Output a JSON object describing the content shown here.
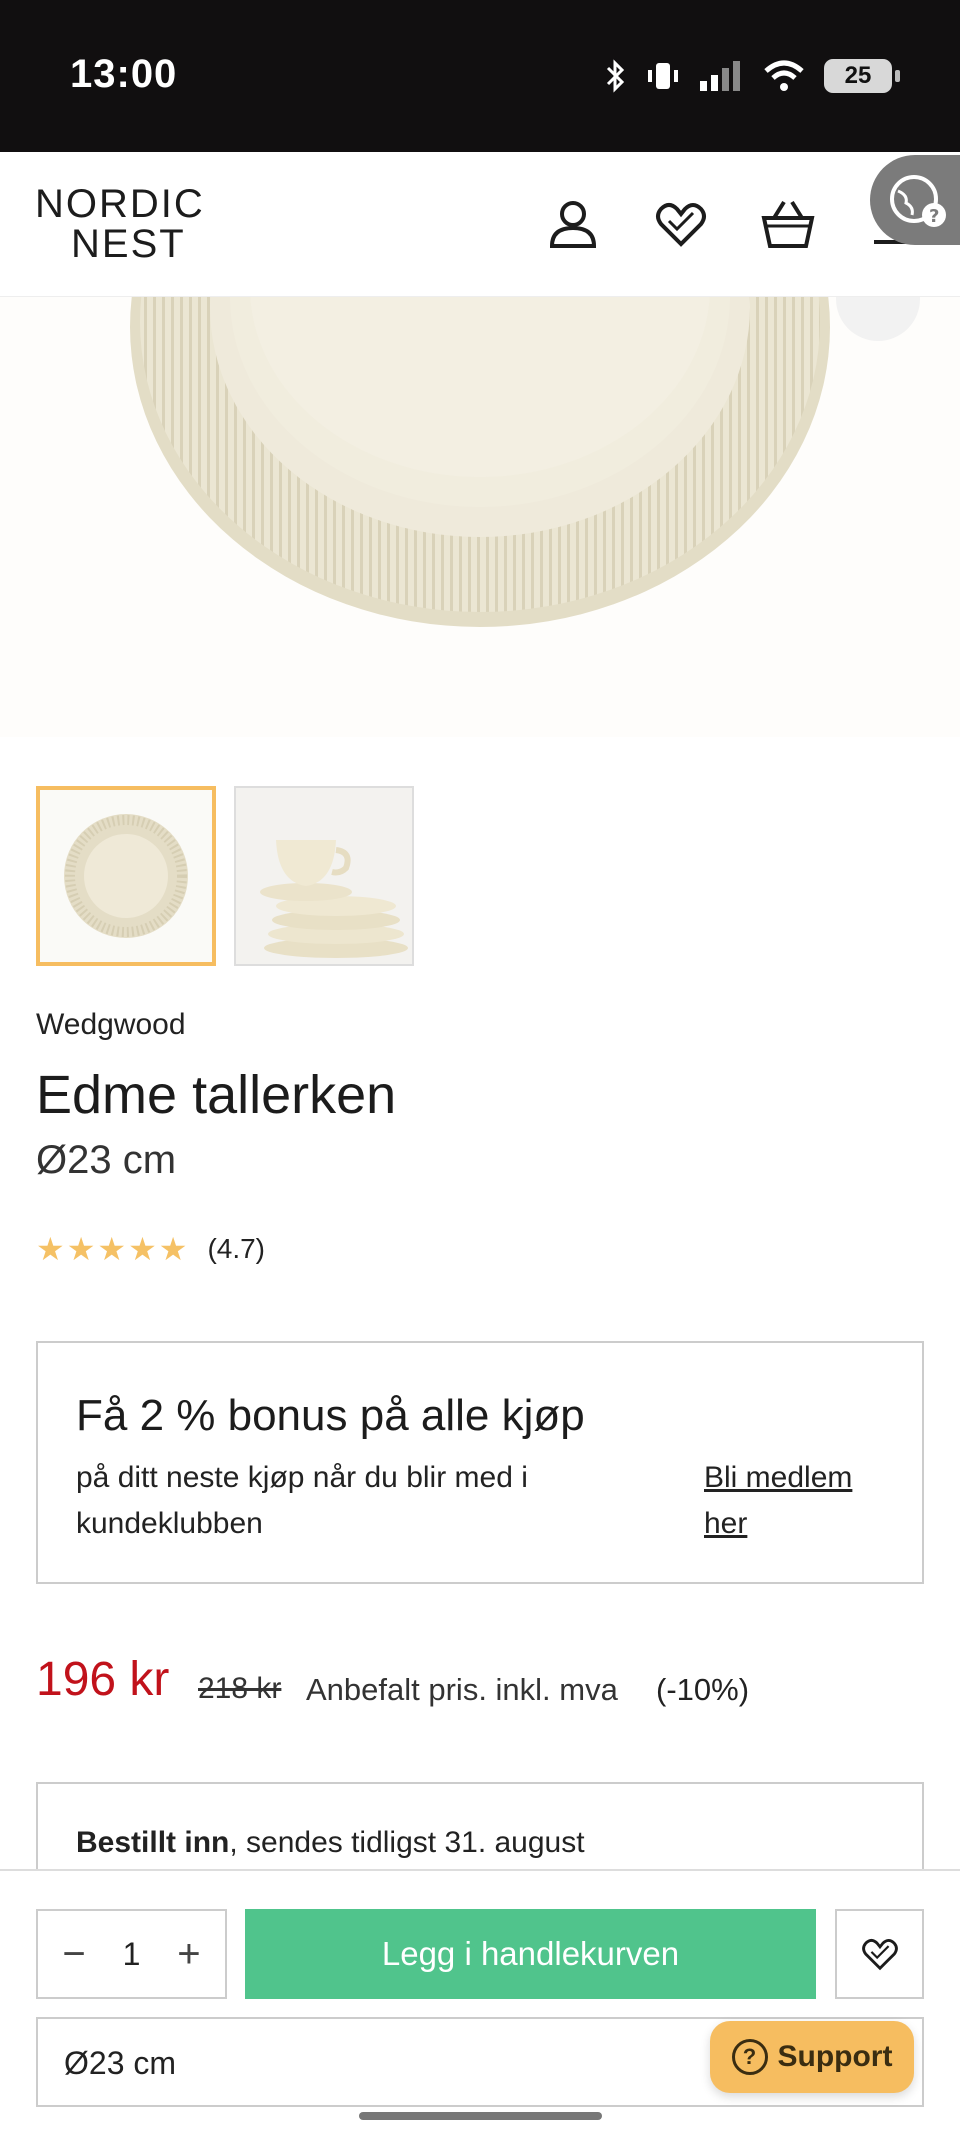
{
  "status_bar": {
    "time": "13:00",
    "battery": "25"
  },
  "header": {
    "logo_line1": "NORDIC",
    "logo_line2": "NEST",
    "icons": [
      "user-icon",
      "heart-icon",
      "basket-icon",
      "menu-icon",
      "globe-icon"
    ]
  },
  "product": {
    "brand": "Wedgwood",
    "title": "Edme tallerken",
    "size": "Ø23 cm",
    "stars": "★★★★★",
    "rating": "(4.7)"
  },
  "bonus": {
    "heading": "Få 2 % bonus på alle kjøp",
    "text": "på ditt neste kjøp når du blir med i kundeklubben",
    "link": "Bli medlem her"
  },
  "pricing": {
    "price": "196 kr",
    "old_price": "218 kr",
    "recommended_label": "Anbefalt pris. inkl. mva",
    "discount": "(-10%)"
  },
  "delivery": {
    "status_bold": "Bestillt inn",
    "status_rest": ", sendes tidligst 31. august"
  },
  "cart_bar": {
    "quantity": "1",
    "minus": "−",
    "plus": "+",
    "add_to_cart": "Legg i handlekurven",
    "variant": "Ø23 cm"
  },
  "support": {
    "label": "Support",
    "icon": "?"
  },
  "colors": {
    "accent_green": "#50c48c",
    "price_red": "#c1121b",
    "highlight": "#f6bd60"
  }
}
